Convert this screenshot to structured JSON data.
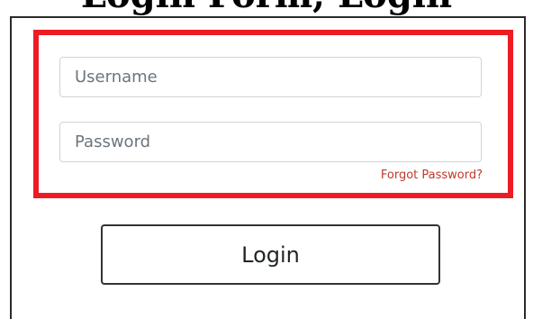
{
  "header": {
    "partial_title": "Login Form, Login"
  },
  "form": {
    "username_placeholder": "Username",
    "password_placeholder": "Password",
    "forgot_password_label": "Forgot Password?",
    "login_button_label": "Login"
  },
  "colors": {
    "highlight_border": "#ed1c24",
    "forgot_link": "#c0392b",
    "panel_border": "#2b2b2b",
    "button_border": "#333333"
  }
}
